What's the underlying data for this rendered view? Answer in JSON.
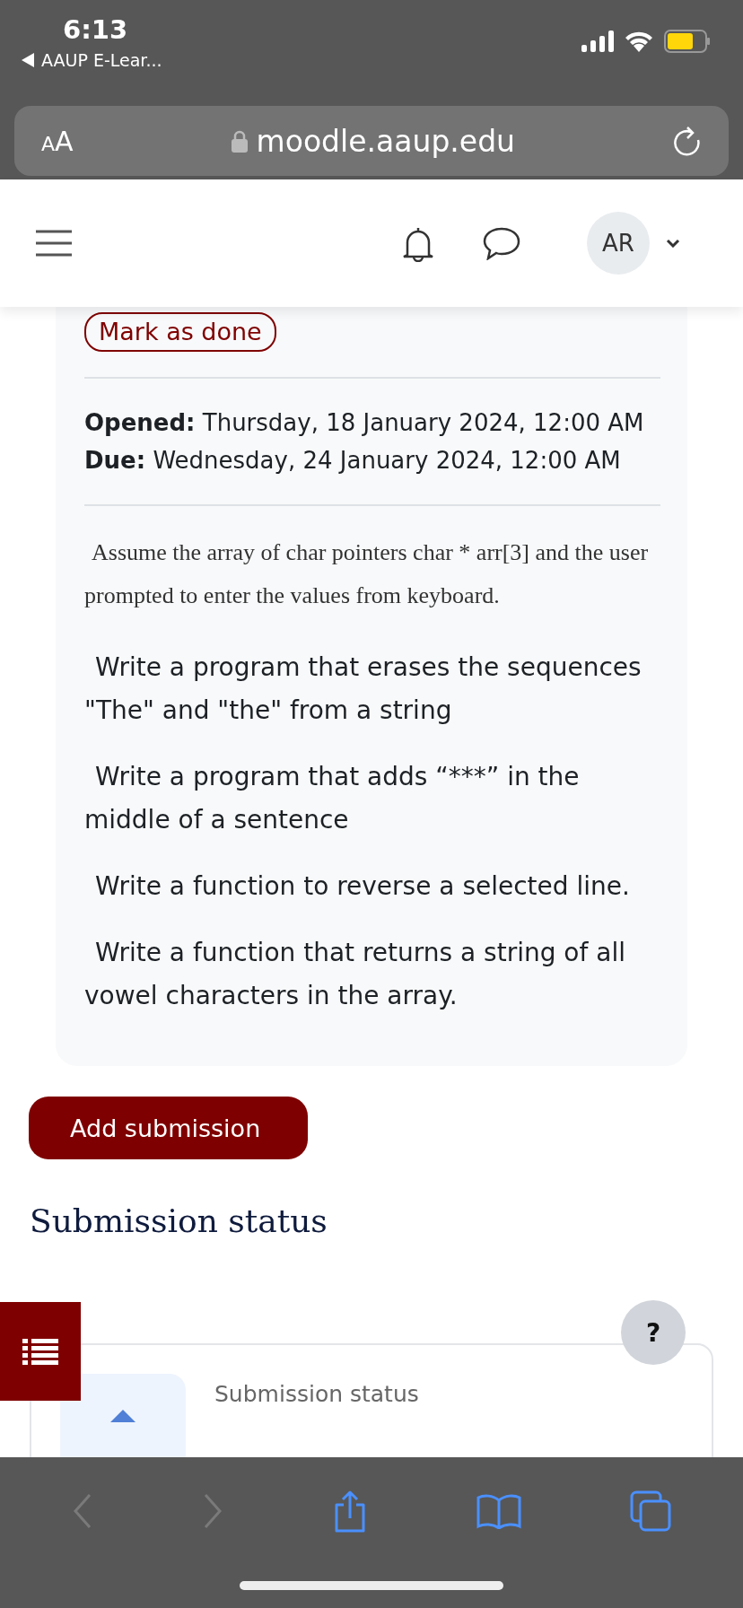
{
  "status_bar": {
    "time": "6:13",
    "back_app": "AAUP E-Lear..."
  },
  "address_bar": {
    "text_size": "AA",
    "url": "moodle.aaup.edu"
  },
  "header": {
    "avatar": "AR"
  },
  "activity": {
    "mark_as_done": "Mark as done",
    "dates": [
      "**Opened:** Thursday, 18 January 2024, 12:00 AM",
      "**Due:** Wednesday, 24 January 2024, 12:00 AM"
    ],
    "intro": "Assume the array of char pointers char * arr[3]  and the user prompted to enter the values from keyboard.",
    "tasks": [
      "Write a program that erases the sequences \"The\" and \"the\" from a string",
      "Write a program that adds “***” in the middle of a sentence",
      "Write a function to reverse a selected line.",
      "Write a function that returns a string of all vowel characters in the array."
    ]
  },
  "add_submission": "Add submission",
  "section_title": "Submission status",
  "help": "?",
  "status_card": {
    "title": "Submission status"
  },
  "toolbar": [
    {
      "kind": "back",
      "disabled": true
    },
    {
      "kind": "forward",
      "disabled": true
    },
    {
      "kind": "share",
      "disabled": false
    },
    {
      "kind": "bookmarks",
      "disabled": false
    },
    {
      "kind": "tabs",
      "disabled": false
    }
  ]
}
